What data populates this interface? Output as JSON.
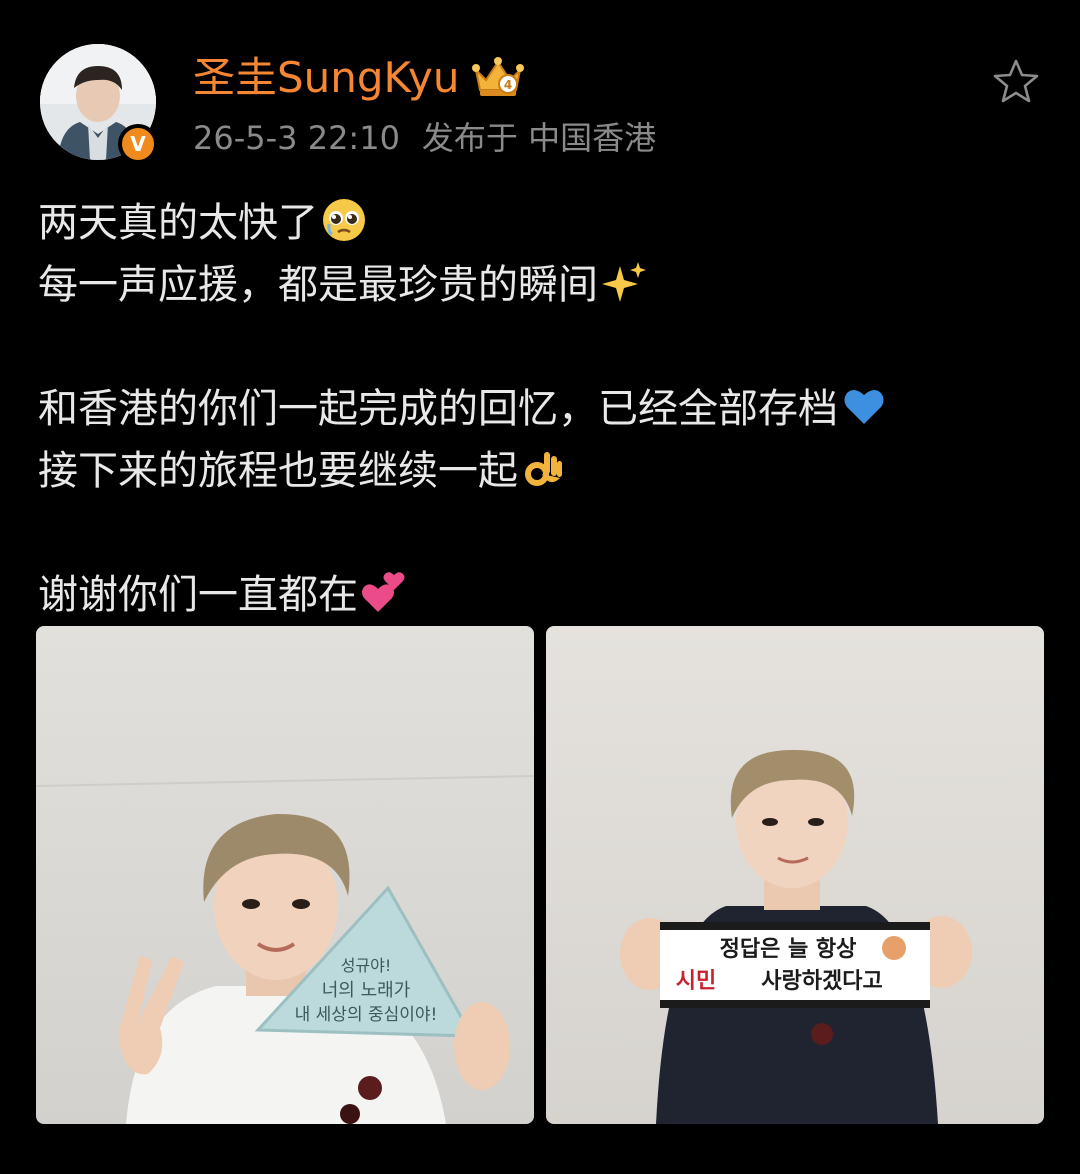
{
  "post": {
    "author": {
      "name": "圣圭SungKyu",
      "verified": true,
      "verified_color": "#f08a1c",
      "name_color": "#f58634",
      "badge": "crown-badge"
    },
    "meta": {
      "timestamp": "26-5-3 22:10",
      "location": "发布于 中国香港"
    },
    "content": {
      "lines": [
        "两天真的太快了",
        "每一声应援，都是最珍贵的瞬间",
        "",
        "和香港的你们一起完成的回忆，已经全部存档",
        "接下来的旅程也要继续一起",
        "",
        "谢谢你们一直都在"
      ],
      "emojis": [
        "pleading-face",
        "sparkles",
        "blue-heart",
        "ok-hand",
        "two-hearts"
      ]
    },
    "photos": [
      {
        "sign_lines": [
          "성규야!",
          "너의 노래가",
          "내 세상의 중심이야!"
        ]
      },
      {
        "sign_lines": [
          "정답은 늘 항상",
          "시민",
          "사랑하겠다고"
        ]
      }
    ]
  },
  "colors": {
    "background": "#000000",
    "text": "#e8e8e8",
    "meta_text": "#8a8a8a",
    "accent": "#f58634"
  }
}
